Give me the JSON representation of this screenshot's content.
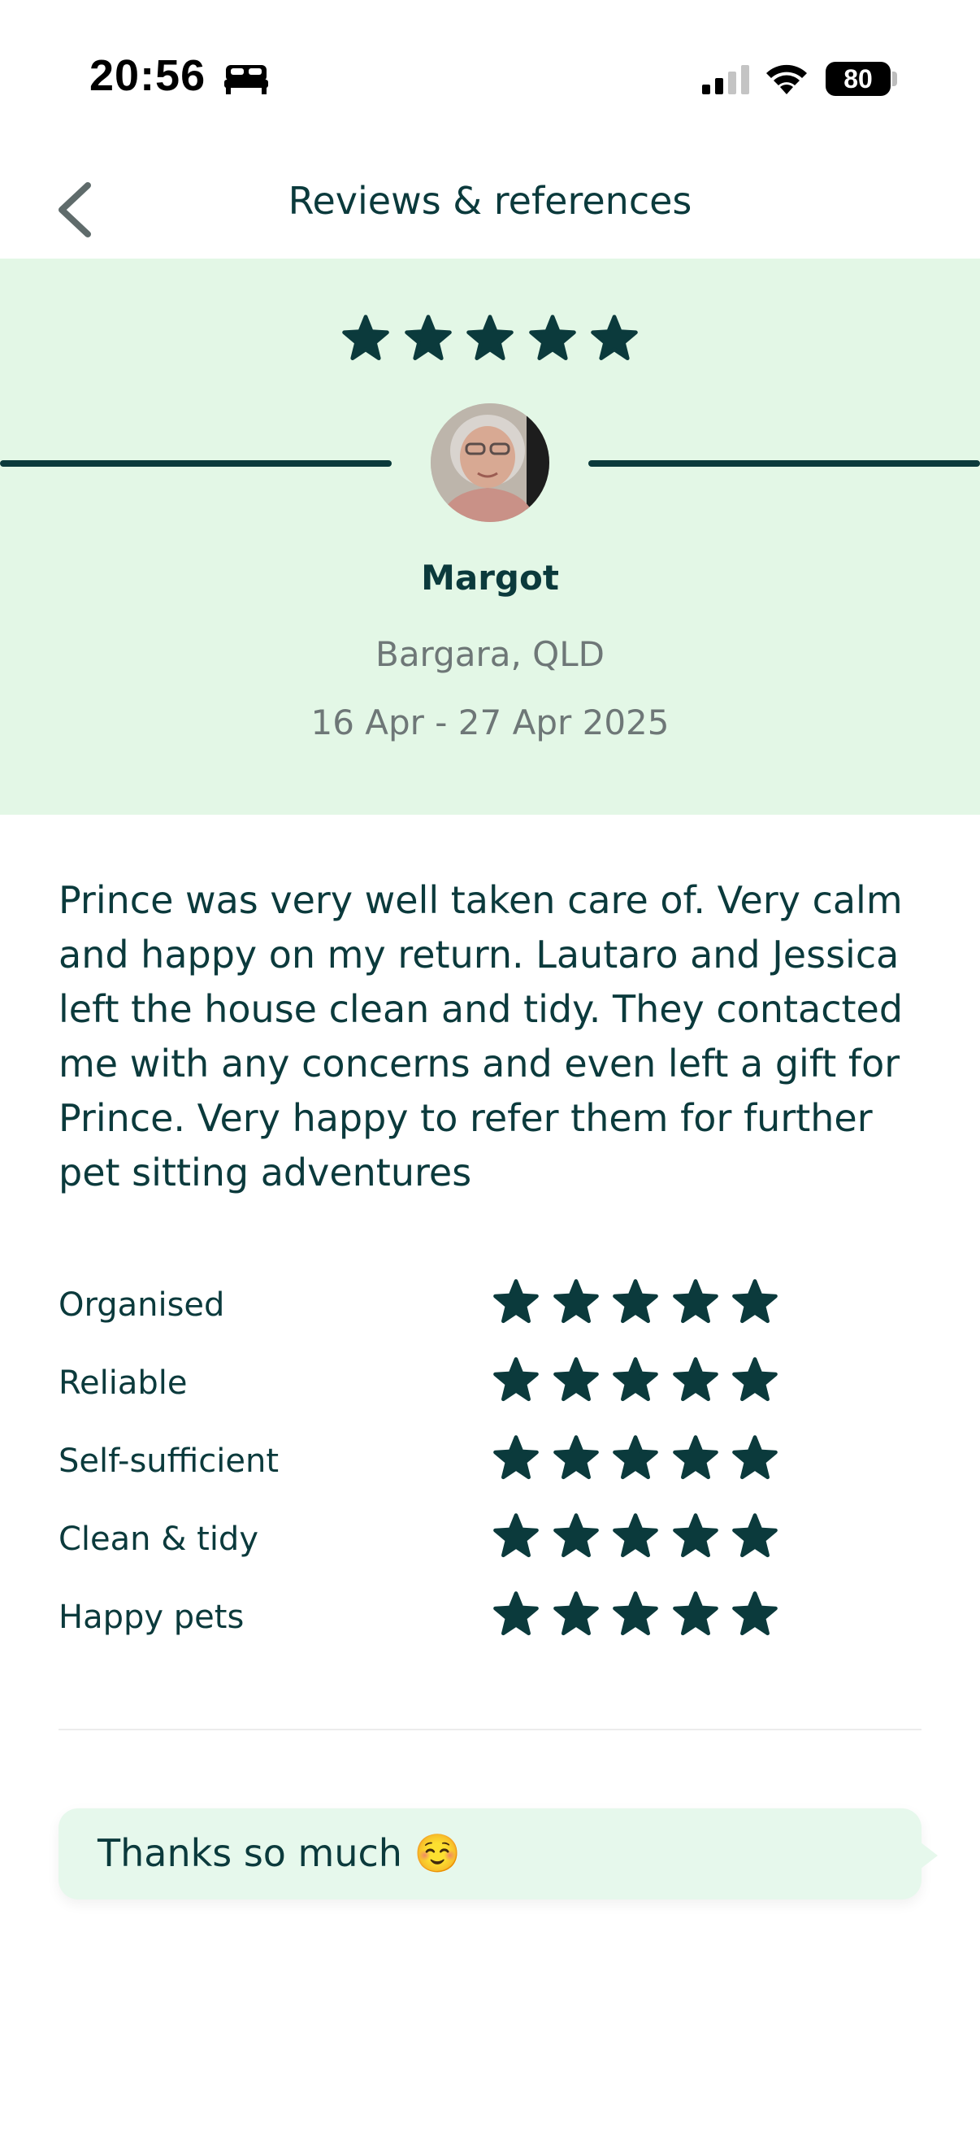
{
  "status_bar": {
    "time": "20:56",
    "battery": "80",
    "icons": [
      "bed-icon",
      "cellular-signal-icon",
      "wifi-icon",
      "battery-icon"
    ]
  },
  "header": {
    "title": "Reviews & references",
    "back_icon": "chevron-left-icon"
  },
  "review": {
    "overall_rating": 5,
    "overall_max": 5,
    "reviewer_name": "Margot",
    "location": "Bargara, QLD",
    "dates": "16 Apr - 27 Apr 2025",
    "text": "Prince was very well taken care of. Very calm and happy on my return. Lautaro and Jessica left the house clean and tidy. They contacted me with any concerns and even left a gift for Prince. Very happy to refer them for further pet sitting adventures",
    "ratings": [
      {
        "label": "Organised",
        "stars": 5
      },
      {
        "label": "Reliable",
        "stars": 5
      },
      {
        "label": "Self-sufficient",
        "stars": 5
      },
      {
        "label": "Clean & tidy",
        "stars": 5
      },
      {
        "label": "Happy pets",
        "stars": 5
      }
    ]
  },
  "reply": {
    "text": "Thanks so much ☺️"
  },
  "colors": {
    "primary": "#0b3a3c",
    "hero_bg": "#e3f7e6",
    "reply_bg": "#e6f8ec",
    "muted_text": "#6e7777"
  }
}
